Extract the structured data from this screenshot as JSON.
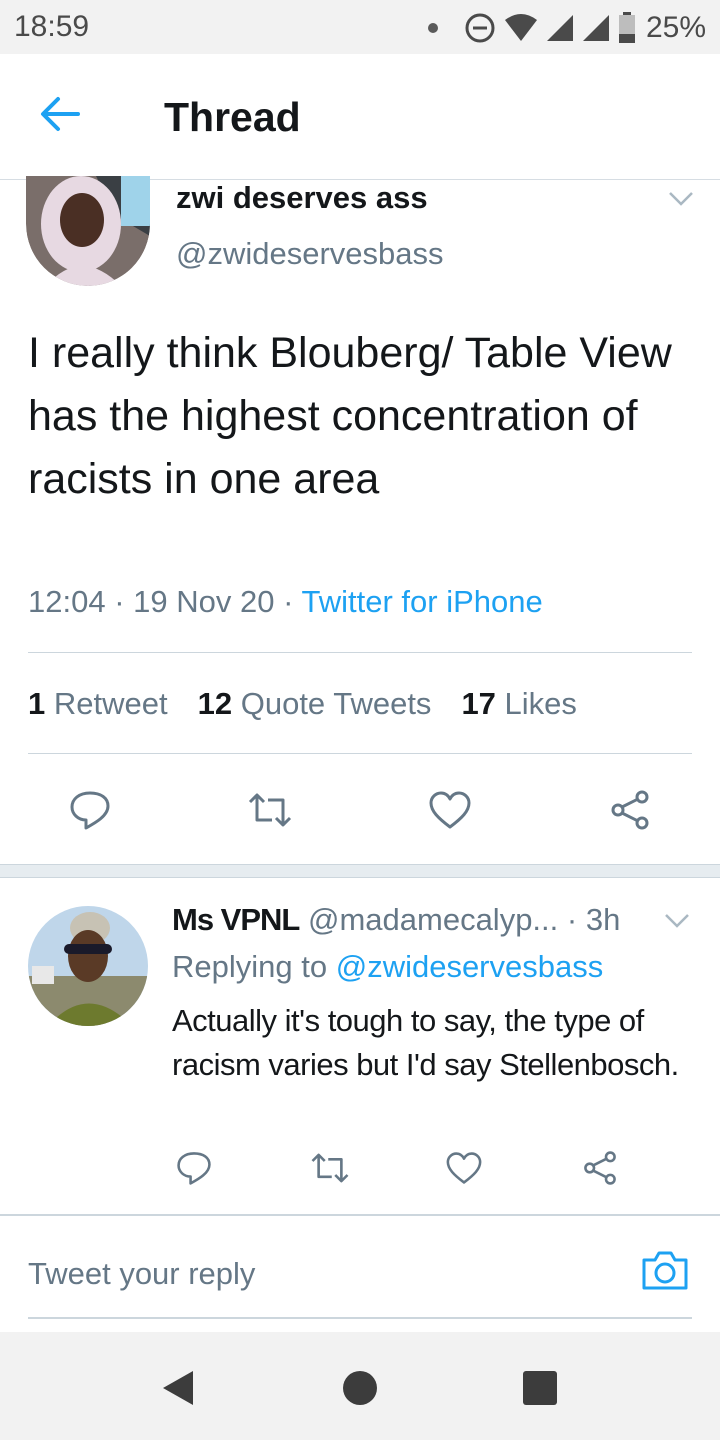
{
  "status_bar": {
    "time": "18:59",
    "battery": "25%",
    "icons": [
      "notification-dot-icon",
      "do-not-disturb-icon",
      "wifi-icon",
      "signal-icon",
      "signal-icon",
      "battery-icon"
    ]
  },
  "header": {
    "back_icon": "arrow-left-icon",
    "title": "Thread",
    "accent_color": "#1da1f2"
  },
  "tweet": {
    "author_name": "zwi deserves ass",
    "author_handle": "@zwideservesbass",
    "text": "I really think Blouberg/ Table View has the highest concentration of racists in one area",
    "time": "12:04",
    "date": "19 Nov 20",
    "separator": "·",
    "source": "Twitter for iPhone",
    "stats": {
      "retweets_count": "1",
      "retweets_label": "Retweet",
      "quotes_count": "12",
      "quotes_label": "Quote Tweets",
      "likes_count": "17",
      "likes_label": "Likes"
    },
    "actions": [
      "reply-icon",
      "retweet-icon",
      "like-icon",
      "share-icon"
    ]
  },
  "reply": {
    "author_name": "Ms VPNL",
    "author_handle": "@madamecalyp...",
    "age": "· 3h",
    "replying_prefix": "Replying to",
    "replying_to": "@zwideservesbass",
    "text": "Actually it's tough to say, the type of racism varies but I'd say Stellenbosch.",
    "actions": [
      "reply-icon",
      "retweet-icon",
      "like-icon",
      "share-icon"
    ]
  },
  "composer": {
    "placeholder": "Tweet your reply",
    "camera_icon": "camera-icon"
  },
  "nav_bar": {
    "buttons": [
      "back-triangle-icon",
      "home-circle-icon",
      "recents-square-icon"
    ]
  }
}
